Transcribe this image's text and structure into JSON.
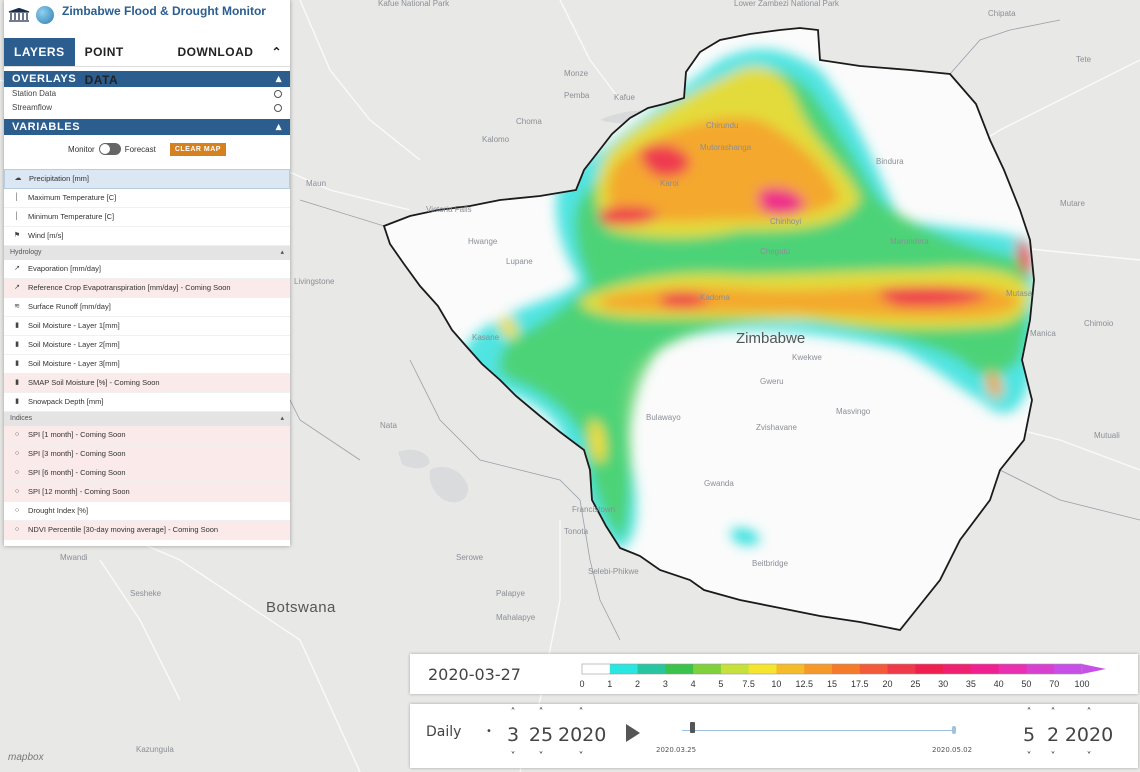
{
  "app": {
    "title": "Zimbabwe Flood & Drought Monitor"
  },
  "tabs": [
    {
      "label": "LAYERS"
    },
    {
      "label": "POINT DATA"
    },
    {
      "label": "DOWNLOAD"
    }
  ],
  "collapse_icon": "double-chevron-up-icon",
  "overlays": {
    "header": "OVERLAYS",
    "items": [
      {
        "label": "Station Data",
        "selected": false
      },
      {
        "label": "Streamflow",
        "selected": false
      }
    ]
  },
  "variables": {
    "header": "VARIABLES",
    "toggle_left": "Monitor",
    "toggle_right": "Forecast",
    "clear_button": "CLEAR MAP",
    "meteorology": [
      {
        "label": "Precipitation [mm]",
        "icon": "cloud-icon",
        "selected": true
      },
      {
        "label": "Maximum Temperature [C]",
        "icon": "thermometer-icon"
      },
      {
        "label": "Minimum Temperature [C]",
        "icon": "thermometer-icon"
      },
      {
        "label": "Wind [m/s]",
        "icon": "flag-icon"
      }
    ],
    "hydrology_group": "Hydrology",
    "hydrology": [
      {
        "label": "Evaporation [mm/day]",
        "icon": "evaporation-icon",
        "soon": false
      },
      {
        "label": "Reference Crop Evapotranspiration [mm/day] - Coming Soon",
        "icon": "evaporation-icon",
        "soon": true
      },
      {
        "label": "Surface Runoff [mm/day]",
        "icon": "runoff-icon",
        "soon": false
      },
      {
        "label": "Soil Moisture - Layer 1[mm]",
        "icon": "soil-icon",
        "soon": false
      },
      {
        "label": "Soil Moisture - Layer 2[mm]",
        "icon": "soil-icon",
        "soon": false
      },
      {
        "label": "Soil Moisture - Layer 3[mm]",
        "icon": "soil-icon",
        "soon": false
      },
      {
        "label": "SMAP Soil Moisture [%] - Coming Soon",
        "icon": "soil-icon",
        "soon": true
      },
      {
        "label": "Snowpack Depth [mm]",
        "icon": "soil-icon",
        "soon": false
      }
    ],
    "indices_group": "Indices",
    "indices": [
      {
        "label": "SPI [1 month] - Coming Soon",
        "soon": true
      },
      {
        "label": "SPI [3 month] - Coming Soon",
        "soon": true
      },
      {
        "label": "SPI [6 month] - Coming Soon",
        "soon": true
      },
      {
        "label": "SPI [12 month] - Coming Soon",
        "soon": true
      },
      {
        "label": "Drought Index [%]",
        "soon": false
      },
      {
        "label": "NDVI Percentile [30-day moving average] - Coming Soon",
        "soon": true
      }
    ]
  },
  "map": {
    "country_label": "Zimbabwe",
    "neighbor_label": "Botswana",
    "place_labels": [
      "Kafue National Park",
      "Lower Zambezi National Park",
      "Monze",
      "Pemba",
      "Choma",
      "Kalomo",
      "Kafue",
      "Chirundu",
      "Karoi",
      "Mutorashanga",
      "Bindura",
      "Mutare",
      "Marondera",
      "Chinhoyi",
      "Chegutu",
      "Kadoma",
      "Kwekwe",
      "Gweru",
      "Masvingo",
      "Zvishavane",
      "Bulawayo",
      "Gwanda",
      "Beitbridge",
      "Francistown",
      "Tonota",
      "Selebi-Phikwe",
      "Palapye",
      "Serowe",
      "Mahalapye",
      "Maun",
      "Nata",
      "Victoria Falls",
      "Hwange",
      "Lupane",
      "Livingstone",
      "Kasane",
      "Mutasa",
      "Chimoio",
      "Manica",
      "Mutuali",
      "Tete",
      "Chipata",
      "Sesheke",
      "Mwandi",
      "Kazungula"
    ],
    "attribution": "mapbox"
  },
  "legend": {
    "date": "2020-03-27",
    "ticks": [
      "0",
      "1",
      "2",
      "3",
      "4",
      "5",
      "7.5",
      "10",
      "12.5",
      "15",
      "17.5",
      "20",
      "25",
      "30",
      "35",
      "40",
      "50",
      "70",
      "100"
    ],
    "colors": [
      "#ffffff",
      "#29e6e0",
      "#27c6a0",
      "#3ac24b",
      "#7fd13c",
      "#c7e03b",
      "#f5e52e",
      "#f5bb2a",
      "#f59a2a",
      "#f57a2a",
      "#f25a3a",
      "#ef3a4a",
      "#ef2050",
      "#f02070",
      "#f02090",
      "#e830b0",
      "#d840d0",
      "#c850e8"
    ]
  },
  "time_control": {
    "interval": "Daily",
    "start": {
      "month": "3",
      "day": "25",
      "year": "2020"
    },
    "end": {
      "month": "5",
      "day": "2",
      "year": "2020"
    },
    "slider_start_label": "2020.03.25",
    "slider_end_label": "2020.05.02",
    "slider_position": 0.03
  }
}
